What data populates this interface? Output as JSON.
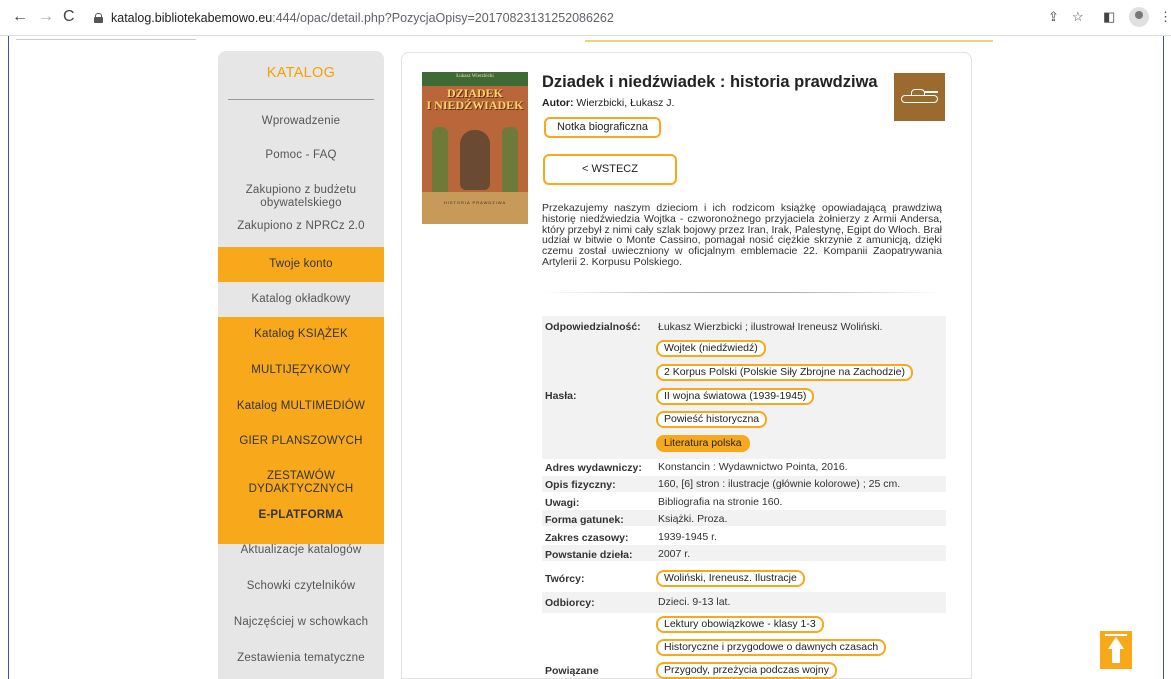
{
  "browser": {
    "url_domain": "katalog.bibliotekabemowo.eu",
    "url_path": ":444/opac/detail.php?PozycjaOpisy=20170823131252086262"
  },
  "sidebar": {
    "title": "KATALOG",
    "items": [
      {
        "label": "Wprowadzenie"
      },
      {
        "label": "Pomoc - FAQ"
      },
      {
        "label": "Zakupiono z budżetu obywatelskiego"
      },
      {
        "label": "Zakupiono z NPRCz 2.0"
      },
      {
        "label": "Twoje konto"
      },
      {
        "label": "Katalog okładkowy"
      },
      {
        "label": "Katalog KSIĄŻEK"
      },
      {
        "label": "MULTIJĘZYKOWY"
      },
      {
        "label": "Katalog MULTIMEDIÓW"
      },
      {
        "label": "GIER PLANSZOWYCH"
      },
      {
        "label": "ZESTAWÓW DYDAKTYCZNYCH"
      },
      {
        "label": "E-PLATFORMA"
      },
      {
        "label": "Aktualizacje katalogów"
      },
      {
        "label": "Schowki czytelników"
      },
      {
        "label": "Najczęściej w schowkach"
      },
      {
        "label": "Zestawienia tematyczne"
      }
    ]
  },
  "book": {
    "cover_author": "Łukasz Wierzbicki",
    "cover_title_line1": "DZIADEK",
    "cover_title_line2": "I NIEDŹWIADEK",
    "cover_subtitle": "HISTORIA PRAWDZIWA",
    "title": "Dziadek i niedźwiadek : historia prawdziwa",
    "author_label": "Autor:",
    "author": "Wierzbicki, Łukasz J.",
    "bio_button": "Notka biograficzna",
    "back_button": "< WSTECZ",
    "description": "Przekazujemy naszym dzieciom i ich rodzicom książkę opowiadającą prawdziwą historię niedźwiedzia Wojtka - czworonożnego przyjaciela żołnierzy z Armii Andersa, który przebył z nimi cały szlak bojowy przez Iran, Irak, Palestynę, Egipt do Włoch. Brał udział w bitwie o Monte Cassino, pomagał nosić ciężkie skrzynie z amunicją, dzięki czemu został uwieczniony w oficjalnym emblemacie 22. Kompanii Zaopatrywania Artylerii 2. Korpusu Polskiego."
  },
  "details": {
    "responsibility_label": "Odpowiedzialność:",
    "responsibility": "Łukasz Wierzbicki ; ilustrował Ireneusz Woliński.",
    "subjects_label": "Hasła:",
    "subjects": [
      "Wojtek (niedźwiedź)",
      "2 Korpus Polski (Polskie Siły Zbrojne na Zachodzie)",
      "II wojna światowa (1939-1945)",
      "Powieść historyczna",
      "Literatura polska"
    ],
    "publisher_label": "Adres wydawniczy:",
    "publisher": "Konstancin : Wydawnictwo Pointa, 2016.",
    "physical_label": "Opis fizyczny:",
    "physical": "160, [6] stron : ilustracje (głównie kolorowe) ; 25 cm.",
    "notes_label": "Uwagi:",
    "notes": "Bibliografia na stronie 160.",
    "genre_label": "Forma gatunek:",
    "genre": "Książki. Proza.",
    "timespan_label": "Zakres czasowy:",
    "timespan": "1939-1945 r.",
    "created_label": "Powstanie dzieła:",
    "created": "2007 r.",
    "creators_label": "Twórcy:",
    "creators": "Woliński, Ireneusz. Ilustracje",
    "audience_label": "Odbiorcy:",
    "audience": "Dzieci. 9-13 lat.",
    "related_label": "Powiązane",
    "related": [
      "Lektury obowiązkowe - klasy 1-3",
      "Historyczne i przygodowe o dawnych czasach",
      "Przygody, przeżycia podczas wojny"
    ]
  },
  "colors": {
    "accent": "#f7a91b",
    "title": "#f5a000"
  }
}
